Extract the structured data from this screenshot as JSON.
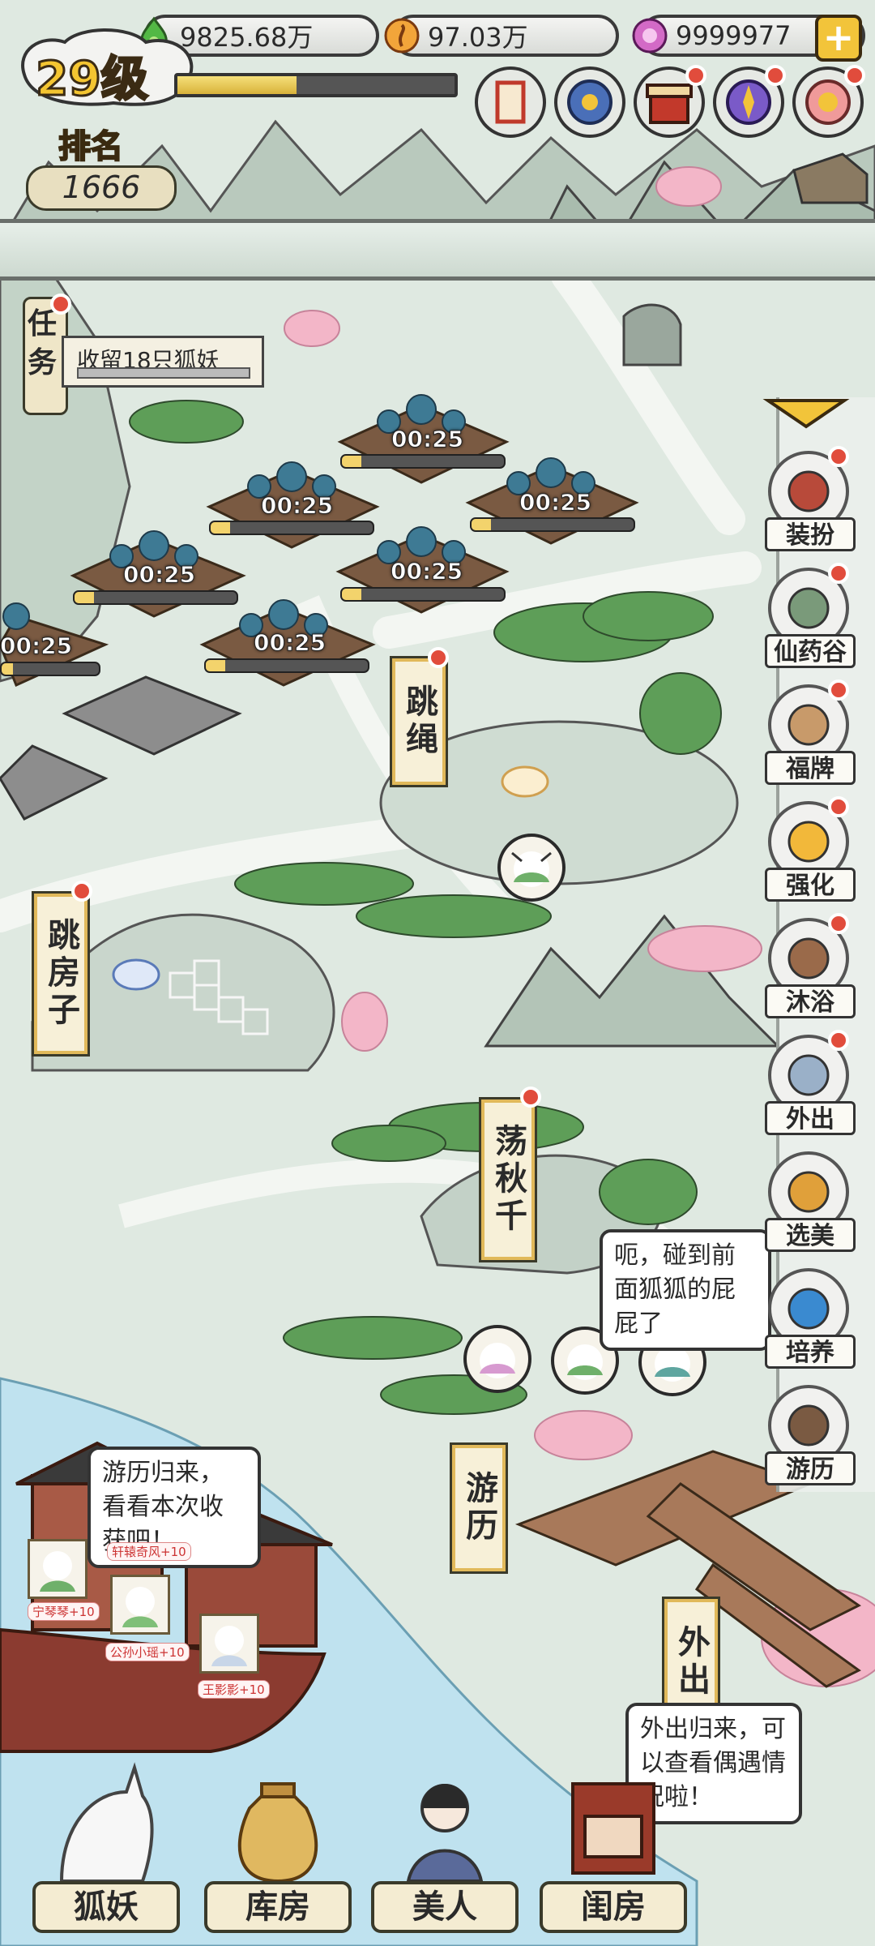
{
  "header": {
    "level": "29级",
    "xp_fraction": 0.43,
    "rank_label": "排名",
    "rank_value": "1666"
  },
  "currencies": [
    {
      "name": "jade-icon",
      "value": "9825.68万",
      "color": "#4caf50"
    },
    {
      "name": "gold-coin-icon",
      "value": "97.03万",
      "color": "#f0a23a"
    },
    {
      "name": "pink-gem-icon",
      "value": "9999977",
      "color": "#c45ab8"
    }
  ],
  "quest": {
    "label": "任务",
    "text": "收留18只狐妖"
  },
  "plots": {
    "timers": [
      "00:25",
      "00:25",
      "00:25",
      "00:25",
      "00:25",
      "00:25",
      "00:25"
    ]
  },
  "signs": {
    "rope": "跳绳",
    "hopscotch": "跳房子",
    "swing": "荡秋千",
    "travel": "游历",
    "outing": "外出"
  },
  "right_menu": [
    {
      "label": "装扮",
      "icon": "vanity-mirror-icon"
    },
    {
      "label": "仙药谷",
      "icon": "mountain-valley-icon"
    },
    {
      "label": "福牌",
      "icon": "fortune-plaque-icon"
    },
    {
      "label": "强化",
      "icon": "flame-icon"
    },
    {
      "label": "沐浴",
      "icon": "bath-tub-icon"
    },
    {
      "label": "外出",
      "icon": "snowy-peak-icon"
    },
    {
      "label": "选美",
      "icon": "golden-fox-icon"
    },
    {
      "label": "培养",
      "icon": "blue-flame-icon"
    },
    {
      "label": "游历",
      "icon": "boat-icon"
    }
  ],
  "bubbles": {
    "swing": "呃，碰到前面狐狐的屁屁了",
    "boat": "游历归来，看看本次收获吧！",
    "outing": "外出归来，可以查看偶遇情况啦！"
  },
  "boat_tags": [
    "轩辕奇风+10",
    "宁琴琴+10",
    "公孙小瑶+10",
    "王影影+10"
  ],
  "bottom_nav": [
    {
      "label": "狐妖",
      "icon": "white-fox-icon"
    },
    {
      "label": "库房",
      "icon": "treasure-sack-icon"
    },
    {
      "label": "美人",
      "icon": "beauty-portrait-icon"
    },
    {
      "label": "闺房",
      "icon": "boudoir-bed-icon"
    }
  ],
  "colors": {
    "accent": "#f4c531",
    "badge": "#e14c3c",
    "water": "#bfe2ef"
  }
}
